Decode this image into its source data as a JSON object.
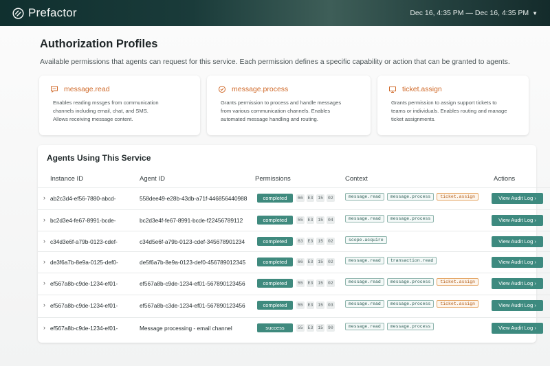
{
  "header": {
    "brand": "Prefactor",
    "date_range": "Dec 16, 4:35 PM — Dec 16, 4:35 PM",
    "icons": [
      "logo-icon",
      "chevron-down-icon"
    ]
  },
  "page": {
    "title": "Authorization Profiles",
    "description": "Available permissions that agents can request for this service. Each permission defines a specific capability or action that can be granted to agents."
  },
  "permissions": [
    {
      "title": "message.read",
      "icon": "message-icon",
      "description_lines": [
        "Enables reading mssges from communication",
        "channels including email, chat, and SMS.",
        "Allows receiving message content."
      ]
    },
    {
      "title": "message.process",
      "icon": "process-icon",
      "description_lines": [
        "Grants permission to process and handle messages",
        "from various communication channels. Enables",
        "automated message handling and routing."
      ]
    },
    {
      "title": "ticket.assign",
      "icon": "ticket-icon",
      "description_lines": [
        "Grants permission to assign support tickets to",
        "teams or individuals. Enables routing and manage",
        "ticket assignments."
      ]
    }
  ],
  "agents": {
    "title": "Agents Using This Service",
    "columns": {
      "instance": "Instance ID",
      "agent": "Agent ID",
      "permissions": "Permissions",
      "context": "Context",
      "actions": "Actions"
    },
    "audit_label": "View Audit Log ›",
    "colors": {
      "status": "#3f8a7e",
      "button": "#3d8a7f",
      "tag_warn": "#e3a462"
    },
    "rows": [
      {
        "instance": "ab2c3d4-ef56-7880-abcd-",
        "agent": "558dee49-e28b-43db-a71f-446856440988",
        "status": "completed",
        "nums": [
          "66",
          "E3",
          "15",
          "02"
        ],
        "context": [
          {
            "text": "message.read",
            "warn": false
          },
          {
            "text": "message.process",
            "warn": false
          },
          {
            "text": "ticket.assign",
            "warn": true
          }
        ]
      },
      {
        "instance": "bc2d3e4-fe67-8991-bcde-",
        "agent": "bc2d3e4f-fe67-8991-bcde-f22456789112",
        "status": "completed",
        "nums": [
          "55",
          "E3",
          "15",
          "04"
        ],
        "context": [
          {
            "text": "message.read",
            "warn": false
          },
          {
            "text": "message.process",
            "warn": false
          }
        ]
      },
      {
        "instance": "c34d3e6f-a79b-0123-cdef-",
        "agent": "c34d5e6f-a79b-0123-cdef-345678901234",
        "status": "completed",
        "nums": [
          "63",
          "E3",
          "15",
          "02"
        ],
        "context": [
          {
            "text": "scope.acquire",
            "warn": false
          }
        ]
      },
      {
        "instance": "de3f6a7b-8e9a-0125-def0-",
        "agent": "de5f6a7b-8e9a-0123-def0-456789012345",
        "status": "completed",
        "nums": [
          "66",
          "E3",
          "15",
          "02"
        ],
        "context": [
          {
            "text": "message.read",
            "warn": false
          },
          {
            "text": "transaction.read",
            "warn": false
          }
        ]
      },
      {
        "instance": "ef567a8b-c9de-1234-ef01-",
        "agent": "ef567a8b-c9de-1234-ef01-567890123456",
        "status": "completed",
        "nums": [
          "55",
          "E3",
          "15",
          "02"
        ],
        "context": [
          {
            "text": "message.read",
            "warn": false
          },
          {
            "text": "message.process",
            "warn": false
          },
          {
            "text": "ticket.assign",
            "warn": true
          }
        ]
      },
      {
        "instance": "ef567a8b-c9de-1234-ef01-",
        "agent": "ef567a8b-c3de-1234-ef01-567890123456",
        "status": "completed",
        "nums": [
          "55",
          "E3",
          "15",
          "03"
        ],
        "context": [
          {
            "text": "message.read",
            "warn": false
          },
          {
            "text": "message.process",
            "warn": false
          },
          {
            "text": "ticket.assign",
            "warn": true
          }
        ]
      },
      {
        "instance": "ef567a8b-c9de-1234-ef01-",
        "agent": "Message processing - email channel",
        "status": "success",
        "nums": [
          "55",
          "E3",
          "15",
          "90"
        ],
        "context": [
          {
            "text": "message.read",
            "warn": false
          },
          {
            "text": "message.process",
            "warn": false
          }
        ]
      }
    ]
  }
}
